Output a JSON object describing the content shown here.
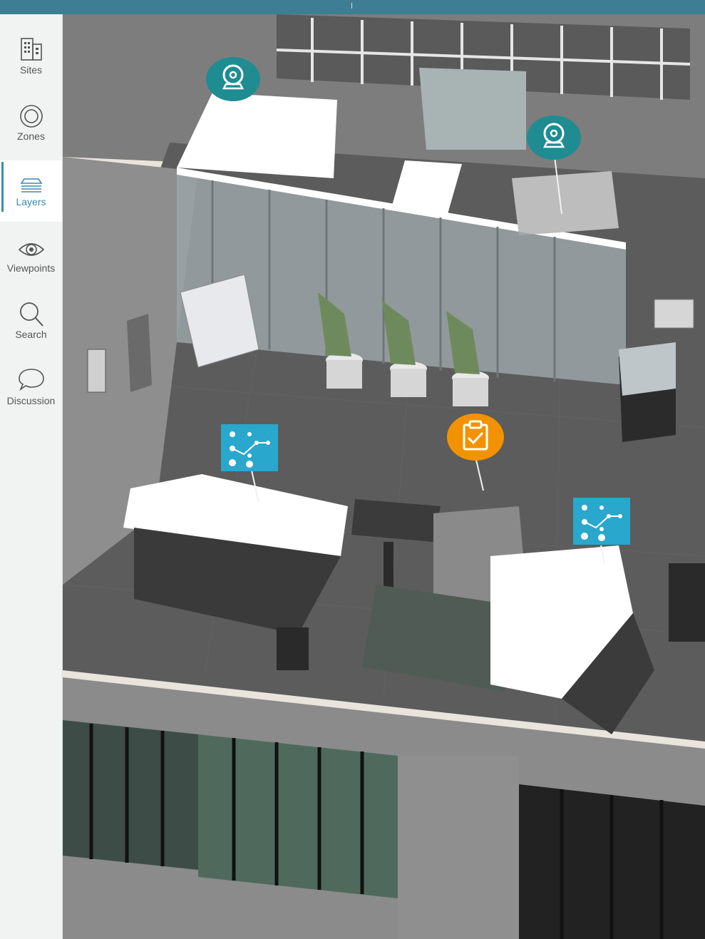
{
  "sidebar": {
    "items": [
      {
        "label": "Sites",
        "icon": "building-icon"
      },
      {
        "label": "Zones",
        "icon": "zone-circle-icon"
      },
      {
        "label": "Layers",
        "icon": "layers-icon",
        "active": true
      },
      {
        "label": "Viewpoints",
        "icon": "eye-icon"
      },
      {
        "label": "Search",
        "icon": "search-icon"
      },
      {
        "label": "Discussion",
        "icon": "chat-bubble-icon"
      }
    ]
  },
  "map": {
    "markers": [
      {
        "type": "camera",
        "icon": "camera-icon",
        "color": "#1f8c92"
      },
      {
        "type": "camera",
        "icon": "camera-icon",
        "color": "#1f8c92"
      },
      {
        "type": "workflow",
        "icon": "workflow-icon",
        "color": "#2aa7cc"
      },
      {
        "type": "task",
        "icon": "clipboard-check-icon",
        "color": "#f39200"
      },
      {
        "type": "workflow",
        "icon": "workflow-icon",
        "color": "#2aa7cc"
      }
    ]
  },
  "colors": {
    "topbar": "#3f7d94",
    "accent": "#3a8cb0",
    "sidebar": "#f1f2f2"
  }
}
